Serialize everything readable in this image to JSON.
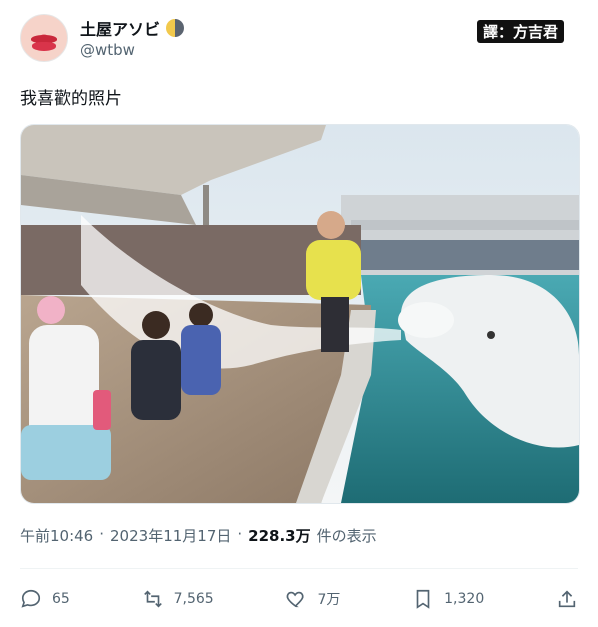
{
  "author": {
    "name": "土屋アソビ",
    "handle": "@wtbw",
    "avatar_icon": "lips-icon",
    "badge_icon": "half-moon-icon"
  },
  "watermark": "譯：方吉君",
  "tweet": {
    "text": "我喜歡的照片",
    "time": "午前10:46",
    "date": "2023年11月17日",
    "views": "228.3万",
    "views_label": "件の表示"
  },
  "actions": {
    "replies": "65",
    "reposts": "7,565",
    "likes": "7万",
    "bookmarks": "1,320"
  },
  "colors": {
    "text": "#0f1419",
    "muted": "#536471"
  }
}
